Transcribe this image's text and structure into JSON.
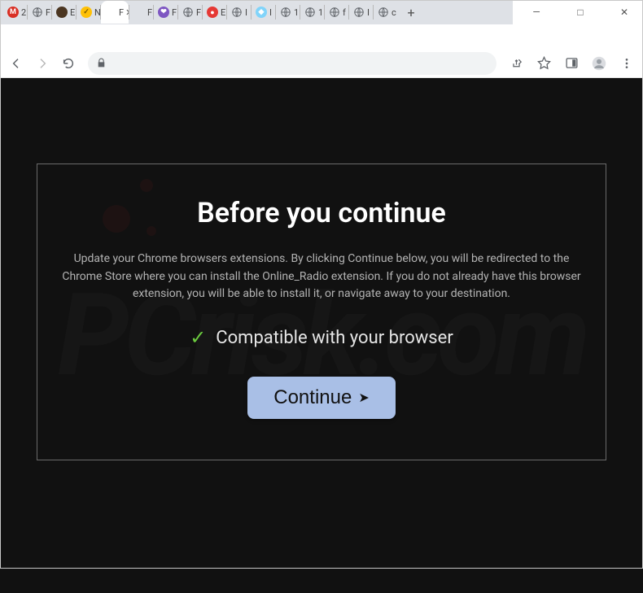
{
  "window": {
    "chevron": "⌄",
    "minimize": "—",
    "maximize": "□",
    "close": "✕"
  },
  "tabs": [
    {
      "favicon_bg": "#d93025",
      "favicon_text": "M",
      "label": "2"
    },
    {
      "favicon_bg": "#5f6368",
      "favicon_text": "",
      "globe": true,
      "label": "F"
    },
    {
      "favicon_bg": "#4b3621",
      "favicon_text": "",
      "label": "E"
    },
    {
      "favicon_bg": "#ffc107",
      "favicon_text": "✓",
      "fg": "#7a5a00",
      "label": "N"
    },
    {
      "favicon_bg": "transparent",
      "favicon_text": "",
      "label": "F",
      "active": true
    },
    {
      "favicon_bg": "transparent",
      "favicon_text": "",
      "label": "F"
    },
    {
      "favicon_bg": "#7e57c2",
      "favicon_text": "❤",
      "label": "F"
    },
    {
      "favicon_bg": "#5f6368",
      "favicon_text": "",
      "globe": true,
      "label": "F"
    },
    {
      "favicon_bg": "#e53935",
      "favicon_text": "●",
      "label": "E"
    },
    {
      "favicon_bg": "#5f6368",
      "favicon_text": "",
      "globe": true,
      "label": "I"
    },
    {
      "favicon_bg": "#81d4fa",
      "favicon_text": "◆",
      "label": "I"
    },
    {
      "favicon_bg": "#5f6368",
      "favicon_text": "",
      "globe": true,
      "label": "1"
    },
    {
      "favicon_bg": "#5f6368",
      "favicon_text": "",
      "globe": true,
      "label": "1"
    },
    {
      "favicon_bg": "#5f6368",
      "favicon_text": "",
      "globe": true,
      "label": "f"
    },
    {
      "favicon_bg": "#5f6368",
      "favicon_text": "",
      "globe": true,
      "label": "I"
    },
    {
      "favicon_bg": "#5f6368",
      "favicon_text": "",
      "globe": true,
      "label": "c"
    }
  ],
  "newtab": "+",
  "modal": {
    "title": "Before you continue",
    "body": "Update your Chrome browsers extensions. By clicking Continue below, you will be redirected to the Chrome Store where you can install the Online_Radio extension. If you do not already have this browser extension, you will be able to install it, or navigate away to your destination.",
    "compat": "Compatible with your browser",
    "check": "✓",
    "button": "Continue",
    "arrow": "➤"
  }
}
